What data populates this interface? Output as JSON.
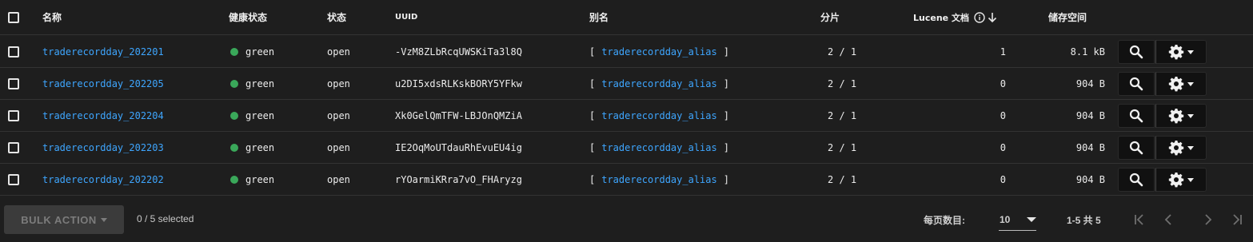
{
  "header": {
    "name": "名称",
    "health": "健康状态",
    "status": "状态",
    "uuid": "UUID",
    "alias": "别名",
    "shards": "分片",
    "lucene_docs": "Lucene 文档",
    "storage": "储存空间"
  },
  "rows": [
    {
      "name": "traderecordday_202201",
      "health": "green",
      "status": "open",
      "uuid": "-VzM8ZLbRcqUWSKiTa3l8Q",
      "alias_open": "[",
      "alias": "traderecordday_alias",
      "alias_close": "]",
      "shards": "2 / 1",
      "docs": "1",
      "storage": "8.1 kB"
    },
    {
      "name": "traderecordday_202205",
      "health": "green",
      "status": "open",
      "uuid": "u2DI5xdsRLKskBORY5YFkw",
      "alias_open": "[",
      "alias": "traderecordday_alias",
      "alias_close": "]",
      "shards": "2 / 1",
      "docs": "0",
      "storage": "904 B"
    },
    {
      "name": "traderecordday_202204",
      "health": "green",
      "status": "open",
      "uuid": "Xk0GelQmTFW-LBJOnQMZiA",
      "alias_open": "[",
      "alias": "traderecordday_alias",
      "alias_close": "]",
      "shards": "2 / 1",
      "docs": "0",
      "storage": "904 B"
    },
    {
      "name": "traderecordday_202203",
      "health": "green",
      "status": "open",
      "uuid": "IE2OqMoUTdauRhEvuEU4ig",
      "alias_open": "[",
      "alias": "traderecordday_alias",
      "alias_close": "]",
      "shards": "2 / 1",
      "docs": "0",
      "storage": "904 B"
    },
    {
      "name": "traderecordday_202202",
      "health": "green",
      "status": "open",
      "uuid": "rYOarmiKRra7vO_FHAryzg",
      "alias_open": "[",
      "alias": "traderecordday_alias",
      "alias_close": "]",
      "shards": "2 / 1",
      "docs": "0",
      "storage": "904 B"
    }
  ],
  "footer": {
    "bulk_action": "BULK ACTION",
    "selected": "0 / 5 selected",
    "rows_per_page_label": "每页数目:",
    "rows_per_page": "10",
    "range": "1-5 共 5"
  },
  "colors": {
    "background": "#1e1e1e",
    "link": "#3ea6ff",
    "health_green": "#3aa85a",
    "button_bg": "#111111"
  },
  "icons": [
    "checkbox-icon",
    "info-icon",
    "sort-arrow-down-icon",
    "search-icon",
    "gear-icon",
    "caret-down-icon",
    "first-page-icon",
    "prev-page-icon",
    "next-page-icon",
    "last-page-icon"
  ]
}
